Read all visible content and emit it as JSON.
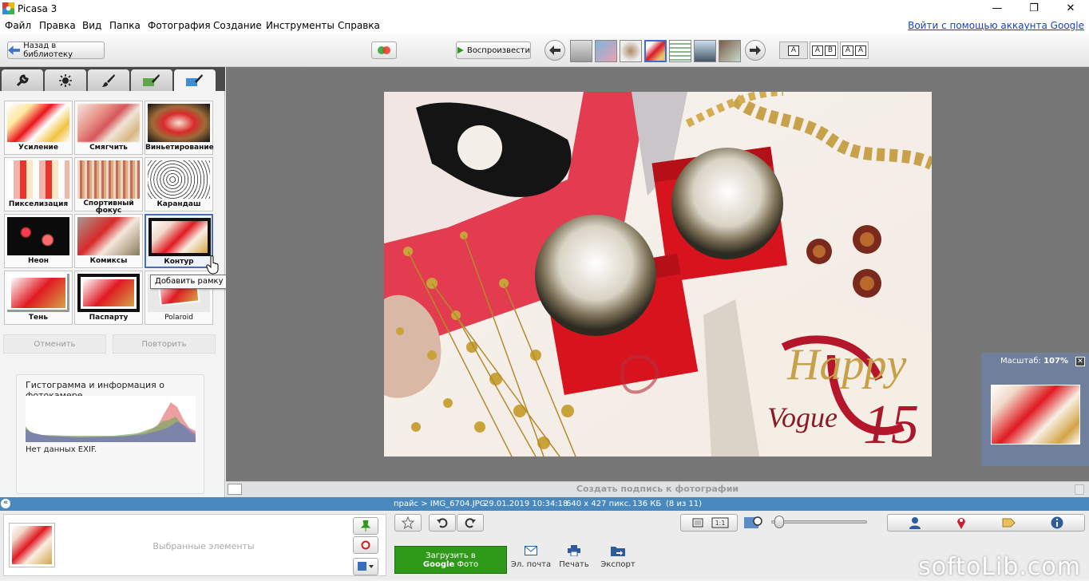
{
  "app": {
    "title": "Picasa 3"
  },
  "window_controls": {
    "minimize": "—",
    "maximize": "❐",
    "close": "✕"
  },
  "menu": [
    "Файл",
    "Правка",
    "Вид",
    "Папка",
    "Фотография",
    "Создание",
    "Инструменты",
    "Справка"
  ],
  "signin_link": "Войти с помощью аккаунта Google",
  "toolbar": {
    "back_label": "Назад в библиотеку",
    "play_label": "Воспроизвести",
    "text_buttons": [
      "A",
      "A",
      "B",
      "A",
      "A"
    ]
  },
  "effects": [
    {
      "label": "Усиление",
      "icon": "enhance-thumb"
    },
    {
      "label": "Смягчить",
      "icon": "soften-thumb"
    },
    {
      "label": "Виньетирование",
      "icon": "vignette-thumb"
    },
    {
      "label": "Пикселизация",
      "icon": "pixelate-thumb"
    },
    {
      "label": "Спортивный фокус",
      "icon": "focal-zoom-thumb"
    },
    {
      "label": "Карандаш",
      "icon": "pencil-sketch-thumb"
    },
    {
      "label": "Неон",
      "icon": "neon-thumb"
    },
    {
      "label": "Комиксы",
      "icon": "comic-thumb"
    },
    {
      "label": "Контур",
      "icon": "border-thumb"
    },
    {
      "label": "Тень",
      "icon": "drop-shadow-thumb"
    },
    {
      "label": "Паспарту",
      "icon": "passe-partout-thumb"
    },
    {
      "label": "Polaroid",
      "icon": "polaroid-thumb"
    }
  ],
  "selected_effect": "Контур",
  "tooltip": "Добавить рамку к фотографии",
  "undo_label": "Отменить",
  "redo_label": "Повторить",
  "histogram": {
    "title": "Гистограмма и информация о фотокамере",
    "exif": "Нет данных EXIF."
  },
  "zoom": {
    "label": "Масштаб:",
    "value": "107%"
  },
  "caption_placeholder": "Создать подпись к фотографии",
  "status": {
    "path": "прайс > IMG_6704.JPG",
    "datetime": "29.01.2019 10:34:18",
    "dimensions": "640 x 427 пикс.",
    "size": "136 КБ",
    "position": "(8 из 11)"
  },
  "tray_label": "Выбранные элементы",
  "upload": {
    "line1": "Загрузить в",
    "brand": "Google",
    "line2": "Фото"
  },
  "exports": [
    {
      "label": "Эл. почта",
      "icon": "email-icon"
    },
    {
      "label": "Печать",
      "icon": "print-icon"
    },
    {
      "label": "Экспорт",
      "icon": "export-icon"
    }
  ],
  "watermark": "softoLib.com",
  "colors": {
    "accent": "#4a89bd",
    "upload_green": "#2f9a1a",
    "viewer_bg": "#777777"
  }
}
